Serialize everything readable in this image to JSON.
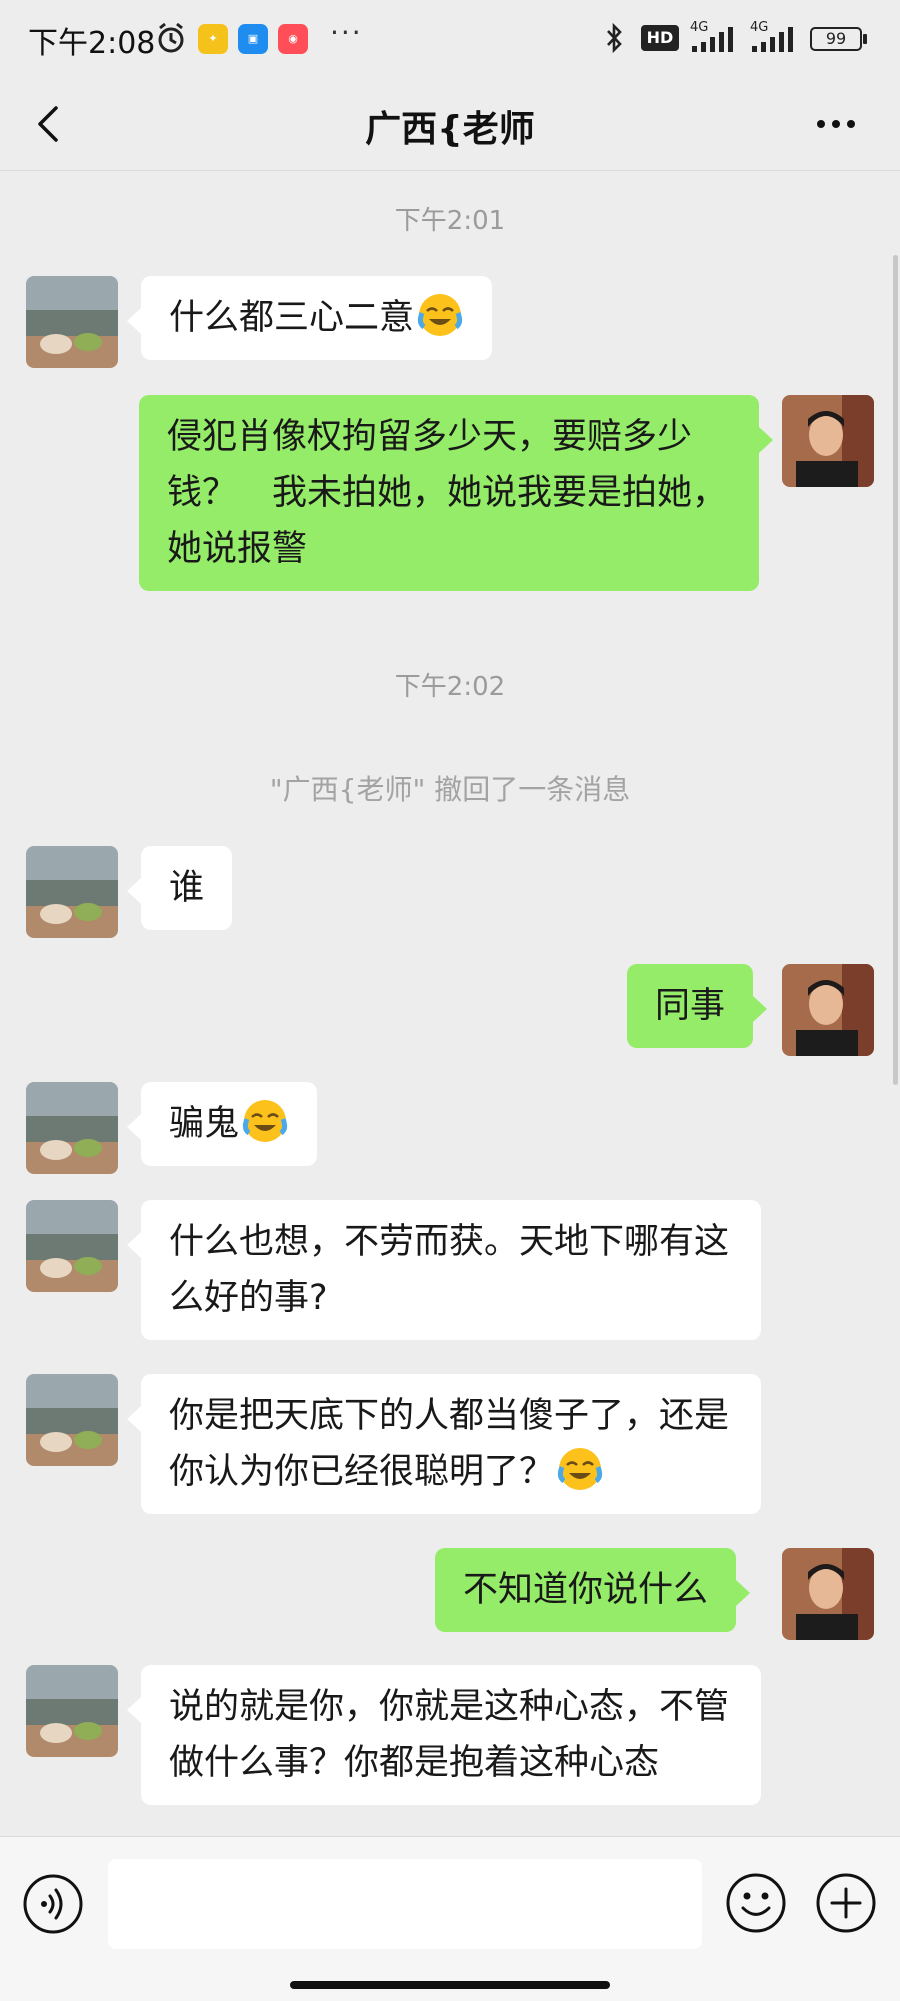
{
  "status_bar": {
    "time": "下午2:08",
    "network_1": "4G",
    "network_2": "4G",
    "battery": "99",
    "hd_label": "HD"
  },
  "header": {
    "title": "广西{老师"
  },
  "messages": {
    "ts1": "下午2:01",
    "m1": "什么都三心二意",
    "m2": "侵犯肖像权拘留多少天，要赔多少钱？　我未拍她，她说我要是拍她，她说报警",
    "ts2": "下午2:02",
    "recall": "\"广西{老师\" 撤回了一条消息",
    "m3": "谁",
    "m4": "同事",
    "m5": "骗鬼",
    "m6": "什么也想，不劳而获。天地下哪有这么好的事?",
    "m7": "你是把天底下的人都当傻子了，还是你认为你已经很聪明了？",
    "m8": "不知道你说什么",
    "m9": "说的就是你，你就是这种心态，不管做什么事？你都是抱着这种心态"
  },
  "input": {
    "value": "",
    "placeholder": ""
  },
  "colors": {
    "background": "#ededed",
    "bubble_self": "#95ec69",
    "bubble_other": "#ffffff"
  },
  "icons": [
    "back-arrow-icon",
    "more-dots-icon",
    "voice-icon",
    "emoji-face-icon",
    "plus-icon",
    "bluetooth-icon",
    "alarm-icon",
    "signal-icon",
    "battery-icon",
    "cry-laugh-emoji"
  ]
}
